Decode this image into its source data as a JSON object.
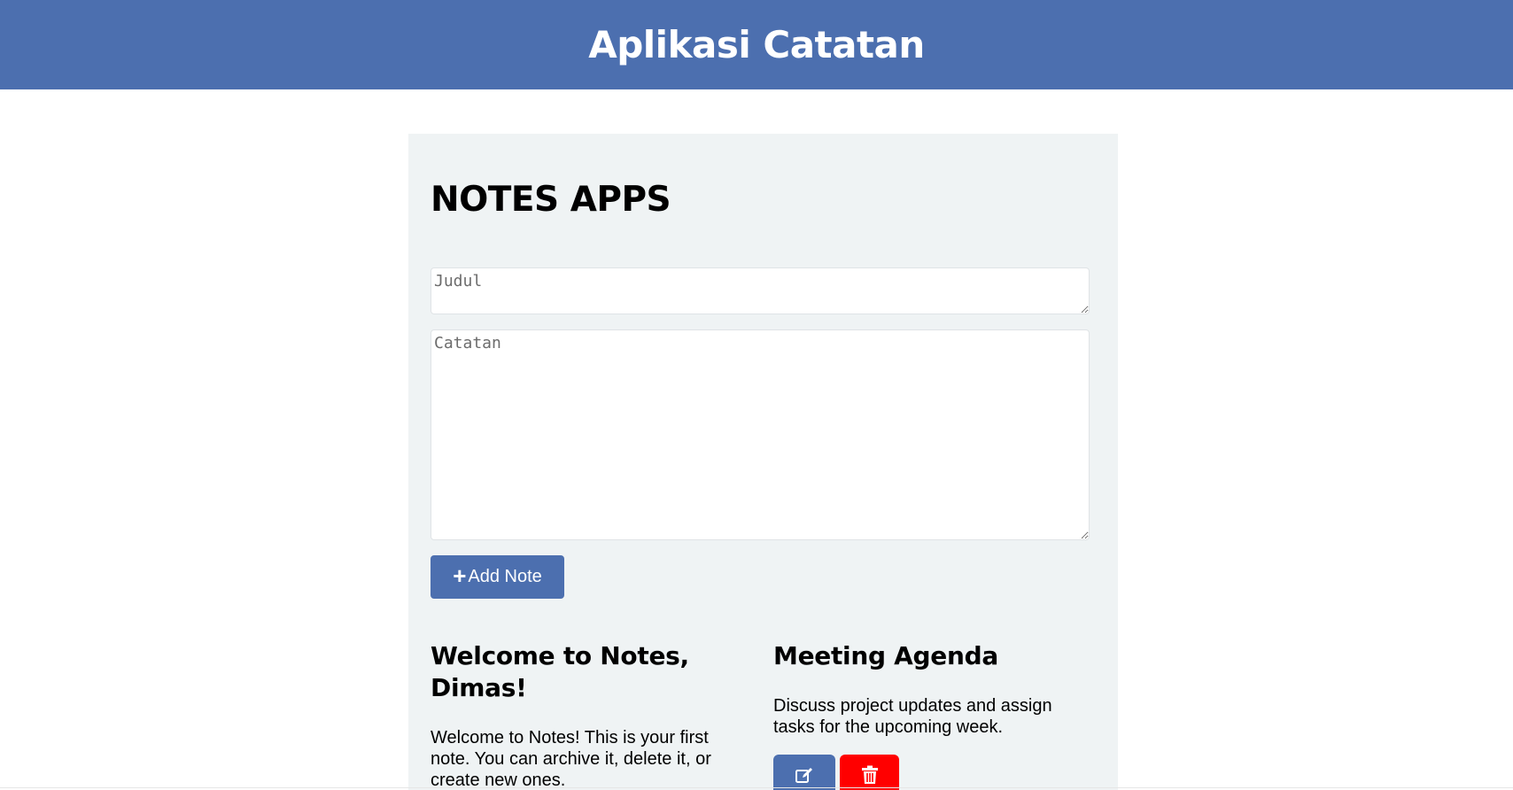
{
  "header": {
    "title": "Aplikasi Catatan"
  },
  "panel": {
    "title": "NOTES APPS"
  },
  "form": {
    "title_placeholder": "Judul",
    "title_value": "",
    "body_placeholder": "Catatan",
    "body_value": "",
    "add_button_icon": "+",
    "add_button_label": "Add Note"
  },
  "notes": [
    {
      "title": "Welcome to Notes, Dimas!",
      "body": "Welcome to Notes! This is your first note. You can archive it, delete it, or create new ones."
    },
    {
      "title": "Meeting Agenda",
      "body": "Discuss project updates and assign tasks for the upcoming week."
    }
  ],
  "icons": {
    "add": "plus-icon",
    "edit": "edit-icon",
    "delete": "trash-icon"
  },
  "colors": {
    "primary": "#4c6faf",
    "danger": "#ff0000",
    "panel_background": "#eff3f4"
  }
}
